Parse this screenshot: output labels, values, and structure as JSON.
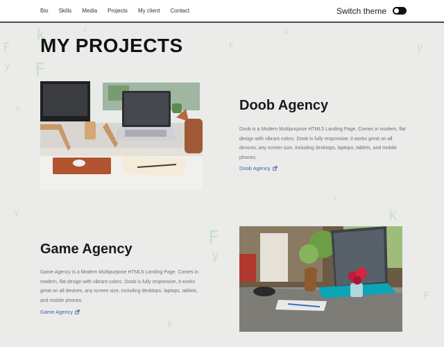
{
  "nav": {
    "items": [
      "Bio",
      "Skills",
      "Media",
      "Projects",
      "My client",
      "Contact"
    ],
    "theme_label": "Switch theme"
  },
  "page": {
    "title": "MY PROJECTS"
  },
  "projects": [
    {
      "title": "Doob Agency",
      "description": "Doob is a Modern Multipurpose HTML5 Landing Page. Comes in modern, flat design with vibrant colors. Doob is fully responsive, it works great on all devices, any screen size, including desktops, laptops, tablets, and mobile phones.",
      "link_label": "Doob Agency"
    },
    {
      "title": "Game Agency",
      "description": "Game Agency is a Modern Multipurpose HTML5 Landing Page. Comes in modern, flat design with vibrant colors. Doob is fully responsive, it works great on all devices, any screen size, including desktops, laptops, tablets, and mobile phones.",
      "link_label": "Game Agency"
    }
  ],
  "colors": {
    "link": "#3e5fa6",
    "background": "#ebebea",
    "rain": "#7fd17f"
  }
}
